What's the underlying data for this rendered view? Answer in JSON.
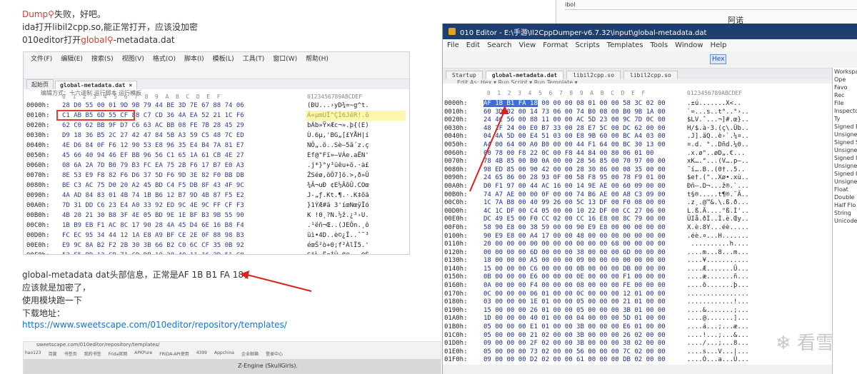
{
  "blog": {
    "line1_prefix": "Dump",
    "line1_suffix": "失败，好吧。",
    "line2": "ida打开libil2cpp.so,能正常打开，应该没加密",
    "line3_prefix": "010editor打开",
    "line3_link": "global",
    "line3_suffix": "-metadata.dat",
    "para1": "global-metadata dat头部信息，正常是AF 1B B1 FA 18，",
    "para2": "应该就是加密了，",
    "para3": "使用模块跑一下",
    "para4": "下载地址：",
    "url": "https://www.sweetscape.com/010editor/repository/templates/",
    "browser_url": "sweetscape.com/010editor/repository/templates/",
    "bookmarks": [
      "hao123",
      "百度",
      "书签页",
      "我的书签",
      "Frida官网",
      "APKPure",
      "FRIDA-API使用",
      "4399",
      "Appchina",
      "企业邮箱",
      "登录中心"
    ],
    "bottom_text": "Z-Engine (SkullGirls)."
  },
  "inner": {
    "menu": [
      "文件(F)",
      "编辑(E)",
      "搜索(S)",
      "视图(V)",
      "格式(O)",
      "脚本(I)",
      "模板(L)",
      "工具(T)",
      "窗口(W)",
      "帮助(H)"
    ],
    "tabs": [
      "起始页",
      "global-metadata.dat ×"
    ],
    "sub": "编辑方式：十六进制  运行脚本  运行模板",
    "header_cols": "0  1  2  3  4  5  6  7  8  9  A  B  C  D  E  F",
    "header_ascii": "0123456789ABCDEF",
    "rows": [
      {
        "a": "0000h:",
        "b": "28 D0 55 00 01 9D 9B 79 44 BE 3D 7E 67 88 74 06",
        "c": "(ÐU...›yD¾=~g^t."
      },
      {
        "a": "0010h:",
        "b": "C1 AB B5 6D 55 CF 88 C7 CD 36 4A EA 52 21 1C F6",
        "c": "Á«µmUÏ^ÇÍ6JêR!.ö"
      },
      {
        "a": "0020h:",
        "b": "62 C0 62 BB 9F D7 C6 63 AC BB 08 FE 7B 28 45 29",
        "c": "bÀb»Ÿ×Æc¬».þ{(E)"
      },
      {
        "a": "0030h:",
        "b": "D9 18 36 B5 2C 27 42 47 84 5B A3 59 C5 48 7C ED",
        "c": "Ù.6µ,'BG„[£YÅH|í"
      },
      {
        "a": "0040h:",
        "b": "4E D6 84 0F F6 12 90 53 E8 96 35 E4 B4 7A 81 E7",
        "c": "NÖ„.ö..Sè–5ä´z.ç"
      },
      {
        "a": "0050h:",
        "b": "45 66 40 94 46 EF BB 96 56 C1 65 1A 61 CB 4E 27",
        "c": "Ef@\"Fï»–VÁe.aËN'"
      },
      {
        "a": "0060h:",
        "b": "08 6A 2A 7D B0 79 B3 FC EA 75 2B F6 17 B7 E0 A3",
        "c": ".j*}°y³üêu+ö.·à£"
      },
      {
        "a": "0070h:",
        "b": "8E 53 E9 F8 82 F6 D6 37 5D F6 9D 3E 82 F0 BB DB",
        "c": "ŽSéø‚öÖ7]ö.>‚ð»Û"
      },
      {
        "a": "0080h:",
        "b": "BE C3 AC 75 D0 20 A2 45 BD C4 F5 DB 8F 43 4F 9C",
        "c": "¾Ã¬uÐ ¢E½ÄõÛ.COœ"
      },
      {
        "a": "0090h:",
        "b": "4A AD 84 83 01 4B 74 1B B6 12 B7 9D 4B 87 F5 E2",
        "c": "J-„ƒ.Kt.¶.·.K‡õâ"
      },
      {
        "a": "00A0h:",
        "b": "7D 31 DD C6 23 E4 A0 33 92 ED 9C 4E 9C FF CF F3",
        "c": "}1ÝÆ#ä 3'íœNœÿÏó"
      },
      {
        "a": "00B0h:",
        "b": "4B 20 21 30 B8 3F 4E 05 BD 9E 1E BF B3 9B 55 90",
        "c": "K !0¸?N.½ž.¿³›U."
      },
      {
        "a": "00C0h:",
        "b": "1B B9 EB F1 AC 8C 17 90 28 4A 45 D4 6E 16 B8 F4",
        "c": ".¹ëñ¬Œ..(JEÔn.¸ô"
      },
      {
        "a": "00D0h:",
        "b": "FC EC 95 34 44 12 1A E8 A9 BF CE 2E 0F 88 98 B3",
        "c": "üì•4D..è©¿Î..ˆ˜³"
      },
      {
        "a": "00E0h:",
        "b": "E9 9C 8A B2 F2 2B 30 3B 66 B2 C0 6C CF 35 0B 92",
        "c": "éœŠ²ò+0;f²ÀlÏ5.'"
      },
      {
        "a": "00F0h:",
        "b": "53 F5 BD 13 CB 71 CD DB 10 38 40 11 16 2D 51 C8",
        "c": "Sõ½.ËqÍÛ.8@..-QÈ"
      }
    ]
  },
  "editor": {
    "title": "010 Editor - E:\\手游\\Il2CppDumper-v6.7.32\\input\\global-metadata.dat",
    "menu": [
      "File",
      "Edit",
      "Search",
      "View",
      "Format",
      "Scripts",
      "Templates",
      "Tools",
      "Window",
      "Help"
    ],
    "tabs": [
      "Startup",
      "global-metadata.dat",
      "libil2cpp.so",
      "libil2cpp.so"
    ],
    "sub": "Edit As: Hex ▾   Run Script ▾   Run Template ▾",
    "header_cols": " 0  1  2  3  4  5  6  7  8  9  A  B  C  D  E  F",
    "header_ascii": "0123456789ABCDEF",
    "sel_bytes": "AF 1B B1 FA 18",
    "rows": [
      {
        "a": "0000h:",
        "b": "00 00 00 08 01 00 00 58 3C 02 00",
        "c": ".±ú.......X<.."
      },
      {
        "a": "0010h:",
        "b": "60 3D 02 00 14 73 06 00 74 B0 08 00 B0 9B 1A 00",
        "c": "`=...s..t°..°›.."
      },
      {
        "a": "0020h:",
        "b": "24 4C 56 00 88 11 00 00 AC 5D 23 00 9C 7D 0C 00",
        "c": "$LV.ˆ...¬]#.œ}.."
      },
      {
        "a": "0030h:",
        "b": "48 2F 24 00 E0 B7 33 00 28 E7 5C 00 DC 62 00 00",
        "c": "H/$.à·3.(ç\\.Üb.."
      },
      {
        "a": "0040h:",
        "b": "04 4A 5D 00 E4 51 03 00 E8 9B 60 00 BC A4 03 00",
        "c": ".J].äQ..è›`.¼¤.."
      },
      {
        "a": "0050h:",
        "b": "A4 00 64 00 A0 B0 00 00 44 F1 64 00 BC 30 13 00",
        "c": "¤.d. °..Dñd.¼0.."
      },
      {
        "a": "0060h:",
        "b": "00 78 00 F8 22 0C 00 F8 44 84 00 80 06 01 00",
        "c": ".x.ø\"..øD„.€..."
      },
      {
        "a": "0070h:",
        "b": "78 4B 85 00 B0 0A 00 00 28 56 85 00 70 97 00 00",
        "c": "xK….°...(V….p—.."
      },
      {
        "a": "0080h:",
        "b": "98 ED 85 00 90 42 00 00 28 30 86 00 08 35 00 00",
        "c": "˜í….B..(0†..5.."
      },
      {
        "a": "0090h:",
        "b": "24 65 86 00 28 93 0F 00 58 F8 95 00 78 F9 01 00",
        "c": "$e†.(\"..Xø•.xù.."
      },
      {
        "a": "00A0h:",
        "b": "D0 F1 97 00 44 AC 16 00 14 9E AE 00 60 09 00 00",
        "c": "Ðñ—.D¬...ž®.`..."
      },
      {
        "a": "00B0h:",
        "b": "74 A7 AE 00 00 0F 00 00 74 B6 AE 00 A8 C3 09 00",
        "c": "t§®.....t¶®.¨Ã.."
      },
      {
        "a": "00C0h:",
        "b": "1C 7A B8 00 40 99 26 00 5C 13 DF 00 F0 08 00 00",
        "c": ".z¸.@™&.\\.ß.ð..."
      },
      {
        "a": "00D0h:",
        "b": "4C 1C DF 00 C4 05 00 00 10 22 DF 00 CC 27 06 00",
        "c": "L.ß.Ä....\"ß.Ì'.."
      },
      {
        "a": "00E0h:",
        "b": "DC 49 E5 00 F0 CC 02 00 CC 16 E8 00 8C 79 00 00",
        "c": "ÜIå.ðÌ..Ì.è.Œy.."
      },
      {
        "a": "00F0h:",
        "b": "58 90 E8 00 38 59 00 00 90 E9 E8 00 00 00 00 00",
        "c": "X.è.8Y...éè....."
      },
      {
        "a": "0100h:",
        "b": "90 E9 E8 00 A4 17 00 00 48 00 00 00 00 00 00 00",
        "c": ".éè.¤...H......."
      },
      {
        "a": "0110h:",
        "b": "20 00 00 00 00 00 00 00 00 00 00 68 00 00 00 00",
        "c": " ..........h...."
      },
      {
        "a": "0120h:",
        "b": "00 00 00 00 6D 00 00 00 38 00 00 00 6D 00 00 00",
        "c": "....m...8...m..."
      },
      {
        "a": "0130h:",
        "b": "18 00 00 00 A5 00 00 00 09 00 00 00 00 00 00 00",
        "c": "....¥..........."
      },
      {
        "a": "0140h:",
        "b": "15 00 00 00 C6 00 00 00 0B 00 00 00 DB 00 00 00",
        "c": "....Æ.......Û..."
      },
      {
        "a": "0150h:",
        "b": "0B 00 00 00 E6 00 00 00 0E 00 00 00 F1 00 00 00",
        "c": "....æ.......ñ..."
      },
      {
        "a": "0160h:",
        "b": "0A 00 00 00 F4 00 00 00 08 00 00 00 FE 00 00 00",
        "c": "....ô.......þ..."
      },
      {
        "a": "0170h:",
        "b": "0C 00 00 00 06 01 00 00 0C 00 00 00 12 01 00 00",
        "c": "................"
      },
      {
        "a": "0180h:",
        "b": "03 00 00 00 1E 01 00 00 05 00 00 00 21 01 00 00",
        "c": "............!..."
      },
      {
        "a": "0190h:",
        "b": "15 00 00 00 26 01 00 00 05 00 00 00 3B 01 00 00",
        "c": "....&.......;..."
      },
      {
        "a": "01A0h:",
        "b": "1D 00 00 00 40 01 00 00 04 00 00 00 5D 01 00 00",
        "c": "....@.......]..."
      },
      {
        "a": "01B0h:",
        "b": "05 00 00 00 E1 01 00 00 3B 00 00 00 E6 01 00 00",
        "c": "....á...;...æ..."
      },
      {
        "a": "01C0h:",
        "b": "05 00 00 00 21 02 00 00 3B 00 00 00 26 02 00 00",
        "c": "....!...;...&..."
      },
      {
        "a": "01D0h:",
        "b": "09 00 00 00 2F 02 00 00 3B 00 00 00 38 02 00 00",
        "c": "..../...;...8..."
      },
      {
        "a": "01E0h:",
        "b": "05 00 00 00 73 02 00 00 56 00 00 00 7C 02 00 00",
        "c": "....s...V...|..."
      },
      {
        "a": "01F0h:",
        "b": "09 00 00 00 D2 02 00 00 61 00 00 00 DB 02 00 00",
        "c": "....Ò...a...Û..."
      }
    ]
  },
  "right_panel": [
    "Workspa",
    "Ope",
    "Favo",
    "Rec",
    "File",
    "Inspecto",
    "Ty",
    "Signed B",
    "Unsigne",
    "Signed S",
    "Unsigne",
    "Signed I",
    "Unsigne",
    "Signed I",
    "Unsigne",
    "Float",
    "Double",
    "Half Flo",
    "String",
    "Unicode"
  ],
  "background_window": {
    "line1": "ibol",
    "line2": "阿诺"
  },
  "watermark": "看雪",
  "colors": {
    "selection": "#3b6fd6",
    "highlight_box": "#e53b2c",
    "arrow": "#d9231c",
    "title_bar": "#1d3e6e"
  }
}
